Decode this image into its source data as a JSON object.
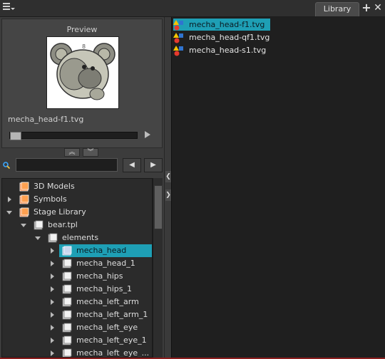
{
  "tabs": {
    "library_label": "Library",
    "add_symbol": "+",
    "close_symbol": "✕"
  },
  "preview": {
    "title": "Preview",
    "filename": "mecha_head-f1.tvg"
  },
  "search": {
    "value": "",
    "prev_label": "◀",
    "next_label": "▶"
  },
  "collapse": {
    "up_label": "︽",
    "down_label": "︾"
  },
  "splitter": {
    "left_label": "❮",
    "right_label": "❯"
  },
  "tree": {
    "items": [
      {
        "label": "3D Models",
        "icon": "folder-orange-icon"
      },
      {
        "label": "Symbols",
        "icon": "folder-orange-icon"
      },
      {
        "label": "Stage Library",
        "icon": "folder-orange-icon"
      },
      {
        "label": "bear.tpl",
        "icon": "template-icon"
      },
      {
        "label": "elements",
        "icon": "template-icon"
      },
      {
        "label": "mecha_head",
        "icon": "element-icon"
      },
      {
        "label": "mecha_head_1",
        "icon": "element-icon"
      },
      {
        "label": "mecha_hips",
        "icon": "element-icon"
      },
      {
        "label": "mecha_hips_1",
        "icon": "element-icon"
      },
      {
        "label": "mecha_left_arm",
        "icon": "element-icon"
      },
      {
        "label": "mecha_left_arm_1",
        "icon": "element-icon"
      },
      {
        "label": "mecha_left_eye",
        "icon": "element-icon"
      },
      {
        "label": "mecha_left_eye_1",
        "icon": "element-icon"
      },
      {
        "label": "mecha_left_eye_...",
        "icon": "element-icon"
      }
    ]
  },
  "library_items": [
    {
      "label": "mecha_head-f1.tvg",
      "icon": "drawing-file-icon"
    },
    {
      "label": "mecha_head-qf1.tvg",
      "icon": "drawing-file-icon"
    },
    {
      "label": "mecha_head-s1.tvg",
      "icon": "drawing-file-icon"
    }
  ],
  "colors": {
    "selection": "#1e9fb5",
    "panel_bg": "#3c3c3c",
    "list_bg": "#2b2b2b",
    "library_bg": "#1f1f1f"
  }
}
